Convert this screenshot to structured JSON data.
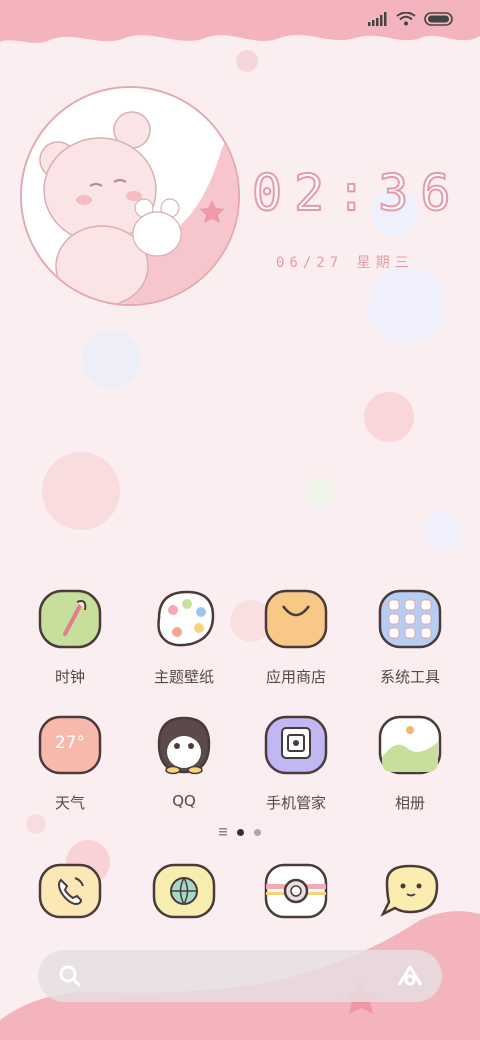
{
  "clock": {
    "time": "02:36",
    "date": "06/27 星期三"
  },
  "apps": [
    {
      "label": "时钟",
      "icon": "clock-feather-icon"
    },
    {
      "label": "主题壁纸",
      "icon": "palette-icon"
    },
    {
      "label": "应用商店",
      "icon": "shopping-bag-icon"
    },
    {
      "label": "系统工具",
      "icon": "tools-folder-icon"
    },
    {
      "label": "天气",
      "icon": "weather-icon",
      "temperature": "27°"
    },
    {
      "label": "QQ",
      "icon": "penguin-icon"
    },
    {
      "label": "手机管家",
      "icon": "safe-icon"
    },
    {
      "label": "相册",
      "icon": "gallery-icon"
    }
  ],
  "page_indicator": {
    "pages": 2,
    "current": 1
  },
  "dock": [
    {
      "name": "phone",
      "icon": "phone-icon"
    },
    {
      "name": "browser",
      "icon": "globe-icon"
    },
    {
      "name": "camera",
      "icon": "camera-icon"
    },
    {
      "name": "messages",
      "icon": "message-bubble-icon"
    }
  ],
  "search": {
    "placeholder": ""
  },
  "colors": {
    "background": "#fbeef0",
    "accent_pink": "#f3b7bf",
    "outline": "#4a3a3a"
  }
}
